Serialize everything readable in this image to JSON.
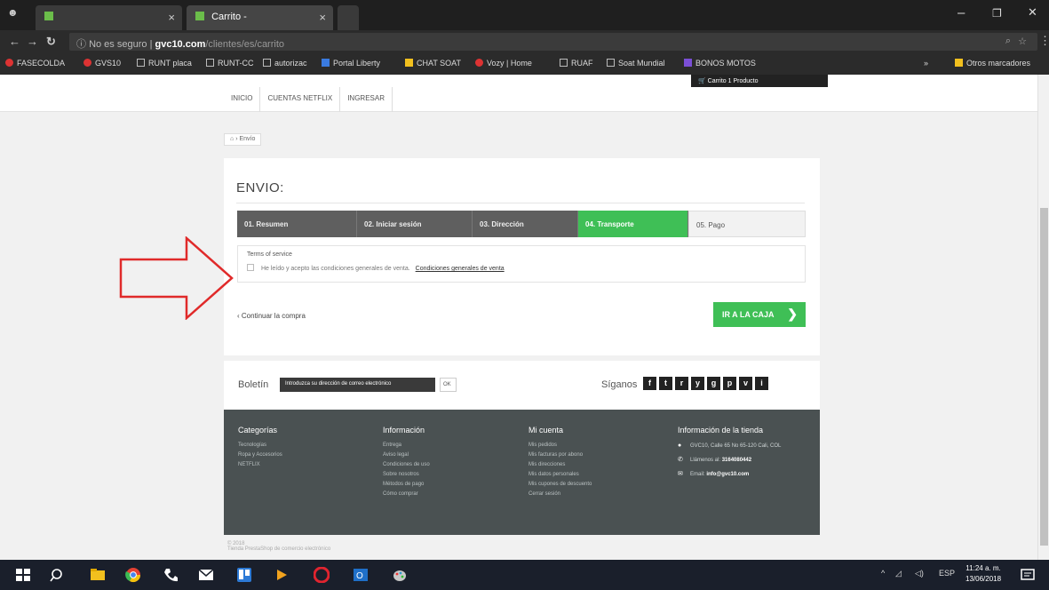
{
  "browser": {
    "tabs": [
      {
        "title": "",
        "close": "×"
      },
      {
        "title": "Carrito -",
        "close": "×"
      }
    ],
    "window_controls": [
      "–",
      "❐",
      "✕"
    ],
    "omnibox": {
      "security": "No es seguro",
      "host": "gvc10.com",
      "path": "/clientes/es/carrito"
    },
    "bookmarks": [
      {
        "label": "FASECOLDA",
        "color": "#dd3333"
      },
      {
        "label": "GVS10",
        "color": "#dd3333"
      },
      {
        "label": "RUNT placa",
        "color": ""
      },
      {
        "label": "RUNT-CC",
        "color": ""
      },
      {
        "label": "autorizac",
        "color": ""
      },
      {
        "label": "Portal Liberty",
        "color": "#3a7be0"
      },
      {
        "label": "CHAT SOAT",
        "color": "#f2c01e"
      },
      {
        "label": "Vozy | Home",
        "color": "#dd3333"
      },
      {
        "label": "RUAF",
        "color": ""
      },
      {
        "label": "Soat Mundial",
        "color": ""
      },
      {
        "label": "BONOS MOTOS",
        "color": "#7b4fd6"
      }
    ],
    "other_bookmarks": "Otros marcadores"
  },
  "header": {
    "cart": "Carrito 1 Producto",
    "nav": [
      "INICIO",
      "CUENTAS NETFLIX",
      "INGRESAR"
    ]
  },
  "breadcrumb": {
    "home": "⌂",
    "current": "Envío"
  },
  "checkout": {
    "title": "ENVIO:",
    "steps": [
      "01. Resumen",
      "02. Iniciar sesión",
      "03. Dirección",
      "04. Transporte",
      "05. Pago"
    ],
    "active_step": 3,
    "terms_title": "Terms of service",
    "terms_text": "He leído y acepto las condiciones generales de venta.",
    "terms_link": "Condiciones generales de venta",
    "continue": "‹ Continuar la compra",
    "checkout_button": "IR A LA CAJA",
    "checkout_chevron": "❯"
  },
  "newsletter": {
    "label": "Boletín",
    "placeholder": "Introduzca su dirección de correo electrónico",
    "ok": "OK",
    "follow_label": "Síganos",
    "social": [
      "f",
      "t",
      "r",
      "y",
      "g",
      "p",
      "v",
      "i"
    ]
  },
  "footer": {
    "categories_title": "Categorías",
    "categories": [
      "Tecnologías",
      "Ropa y Accesorios",
      "NETFLIX"
    ],
    "info_title": "Información",
    "info": [
      "Entrega",
      "Aviso legal",
      "Condiciones de uso",
      "Sobre nosotros",
      "Métodos de pago",
      "Cómo comprar"
    ],
    "account_title": "Mi cuenta",
    "account": [
      "Mis pedidos",
      "Mis facturas por abono",
      "Mis direcciones",
      "Mis datos personales",
      "Mis cupones de descuento",
      "Cerrar sesión"
    ],
    "store_title": "Información de la tienda",
    "store_address": "GVC10, Calle 65 No 65-120 Cali, COL",
    "store_phone_label": "Llámenos al:",
    "store_phone": "3164080442",
    "store_email_label": "Email:",
    "store_email": "info@gvc10.com",
    "copyright": "© 2018",
    "powered": "Tienda PrestaShop de comercio electrónico"
  },
  "taskbar": {
    "tray_lang": "ESP",
    "time": "11:24 a. m.",
    "date": "13/06/2018"
  },
  "colors": {
    "accent_green": "#3fbf56",
    "step_gray": "#5f5f5f",
    "footer_bg": "#4a5152",
    "annotation_red": "#e02a2a"
  }
}
